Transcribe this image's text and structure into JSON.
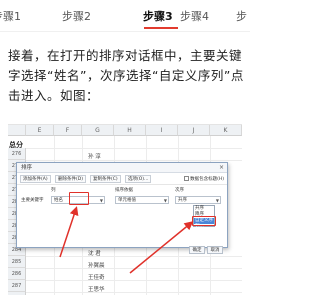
{
  "tabs": [
    {
      "label": "步骤1",
      "active": false
    },
    {
      "label": "步骤2",
      "active": false
    },
    {
      "label": "步骤3",
      "active": true
    },
    {
      "label": "步骤4",
      "active": false
    },
    {
      "label": "步",
      "active": false
    }
  ],
  "colors": {
    "accent": "#e23b2e",
    "highlight": "#e0312a",
    "selection": "#4a86d8"
  },
  "paragraph": "接着，在打开的排序对话框中，主要关键字选择“姓名”，次序选择“自定义序列”点击进入。如图：",
  "sheet": {
    "columns": [
      "E",
      "F",
      "G",
      "H",
      "I",
      "J",
      "K"
    ],
    "header_cell": "总分",
    "rows": [
      "276",
      "277",
      "278",
      "279",
      "280",
      "281",
      "282",
      "283",
      "284",
      "285",
      "286",
      "287",
      "288"
    ],
    "names_top": [
      "孙 淳"
    ],
    "names_bottom": [
      "沈 君",
      "孙翼晨",
      "王佳奇",
      "王思华",
      "沈 雪"
    ]
  },
  "dialog": {
    "title": "排序",
    "close": "×",
    "toolbar": {
      "add": "添加条件(A)",
      "delete": "删除条件(D)",
      "copy": "复制条件(C)",
      "options": "选项(O)...",
      "header_checkbox": "数据包含标题(H)"
    },
    "columns": {
      "col": "列",
      "sort_on": "排序依据",
      "order": "次序"
    },
    "row": {
      "label": "主要关键字",
      "key": "姓名",
      "sort_on": "单元格值",
      "order": "升序"
    },
    "order_options": [
      "升序",
      "降序",
      "自定义序列..."
    ],
    "ok": "确定",
    "cancel": "取消"
  }
}
